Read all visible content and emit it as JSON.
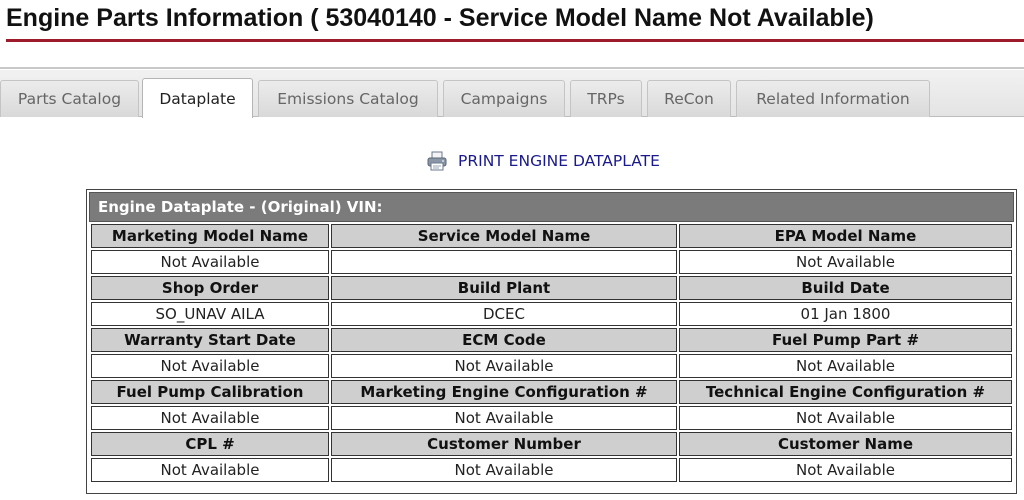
{
  "page": {
    "title": "Engine Parts Information ( 53040140 -  Service Model Name Not Available)"
  },
  "tabs": [
    {
      "label": "Parts Catalog",
      "active": false
    },
    {
      "label": "Dataplate",
      "active": true
    },
    {
      "label": "Emissions Catalog",
      "active": false
    },
    {
      "label": "Campaigns",
      "active": false
    },
    {
      "label": "TRPs",
      "active": false
    },
    {
      "label": "ReCon",
      "active": false
    },
    {
      "label": "Related Information",
      "active": false
    }
  ],
  "print": {
    "label": "PRINT ENGINE DATAPLATE",
    "icon": "printer-icon"
  },
  "dataplate": {
    "header": "Engine Dataplate - (Original)  VIN:",
    "rows": [
      {
        "labels": [
          "Marketing Model Name",
          "Service Model Name",
          "EPA Model Name"
        ],
        "values": [
          "Not Available",
          "",
          "Not Available"
        ]
      },
      {
        "labels": [
          "Shop Order",
          "Build Plant",
          "Build Date"
        ],
        "values": [
          "SO_UNAV AILA",
          "DCEC",
          "01 Jan 1800"
        ]
      },
      {
        "labels": [
          "Warranty Start Date",
          "ECM Code",
          "Fuel Pump Part #"
        ],
        "values": [
          "Not Available",
          "Not Available",
          "Not Available"
        ]
      },
      {
        "labels": [
          "Fuel Pump Calibration",
          "Marketing Engine Configuration #",
          "Technical Engine Configuration #"
        ],
        "values": [
          "Not Available",
          "Not Available",
          "Not Available"
        ]
      },
      {
        "labels": [
          "CPL #",
          "Customer Number",
          "Customer Name"
        ],
        "values": [
          "Not Available",
          "Not Available",
          "Not Available"
        ]
      }
    ]
  },
  "colors": {
    "title_rule": "#9e1b2b",
    "link": "#1a1a8c",
    "header_bg": "#7b7b7b",
    "label_bg": "#cfcfcf"
  }
}
